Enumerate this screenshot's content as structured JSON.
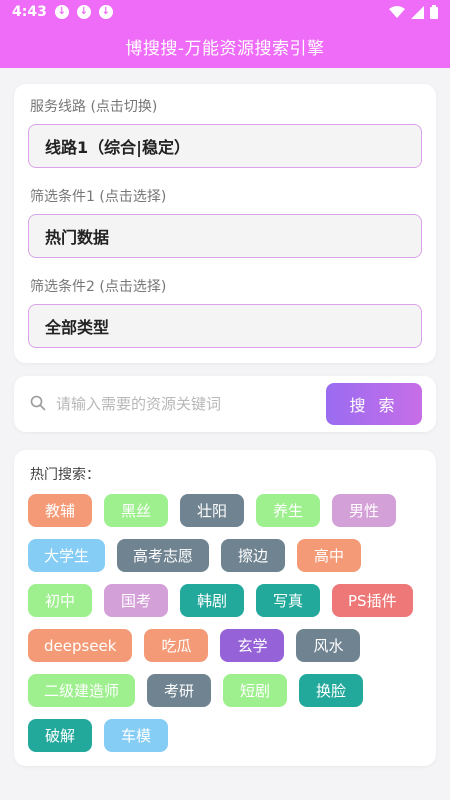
{
  "status_bar": {
    "time": "4:43",
    "download_icons": [
      "download-icon",
      "download-icon",
      "download-icon"
    ]
  },
  "header": {
    "title": "博搜搜-万能资源搜索引擎"
  },
  "filters": {
    "route_label": "服务线路 (点击切换)",
    "route_value": "线路1（综合|稳定）",
    "filter1_label": "筛选条件1 (点击选择)",
    "filter1_value": "热门数据",
    "filter2_label": "筛选条件2 (点击选择)",
    "filter2_value": "全部类型"
  },
  "search": {
    "placeholder": "请输入需要的资源关键词",
    "button_label": "搜 索"
  },
  "hot": {
    "title": "热门搜索：",
    "tags": [
      {
        "label": "教辅",
        "color": "#f59a76"
      },
      {
        "label": "黑丝",
        "color": "#9ef08e"
      },
      {
        "label": "壮阳",
        "color": "#6f8391"
      },
      {
        "label": "养生",
        "color": "#9ef08e"
      },
      {
        "label": "男性",
        "color": "#d4a0d8"
      },
      {
        "label": "大学生",
        "color": "#86cdf6"
      },
      {
        "label": "高考志愿",
        "color": "#6f8391"
      },
      {
        "label": "擦边",
        "color": "#6f8391"
      },
      {
        "label": "高中",
        "color": "#f59a76"
      },
      {
        "label": "初中",
        "color": "#9ef08e"
      },
      {
        "label": "国考",
        "color": "#d4a0d8"
      },
      {
        "label": "韩剧",
        "color": "#23a99c"
      },
      {
        "label": "写真",
        "color": "#23a99c"
      },
      {
        "label": "PS插件",
        "color": "#ee7878"
      },
      {
        "label": "deepseek",
        "color": "#f59a76"
      },
      {
        "label": "吃瓜",
        "color": "#f59a76"
      },
      {
        "label": "玄学",
        "color": "#9662d8"
      },
      {
        "label": "风水",
        "color": "#6f8391"
      },
      {
        "label": "二级建造师",
        "color": "#9ef08e"
      },
      {
        "label": "考研",
        "color": "#6f8391"
      },
      {
        "label": "短剧",
        "color": "#9ef08e"
      },
      {
        "label": "换脸",
        "color": "#23a99c"
      },
      {
        "label": "破解",
        "color": "#23a99c"
      },
      {
        "label": "车模",
        "color": "#86cdf6"
      }
    ]
  }
}
